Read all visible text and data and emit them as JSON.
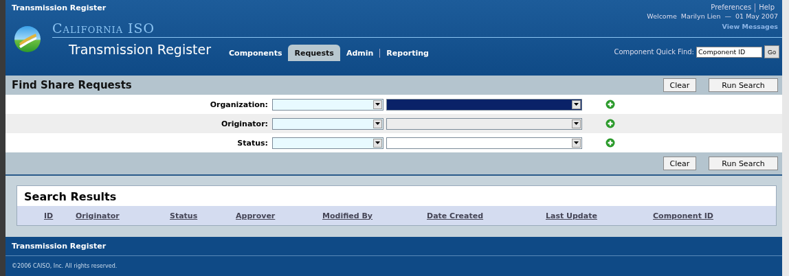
{
  "app_title": "Transmission Register",
  "header_links": [
    {
      "label": "Preferences"
    },
    {
      "label": "Help"
    }
  ],
  "welcome": "Welcome  Marilyn Lien  —  01 May 2007",
  "view_messages": "View Messages",
  "logo_text": "California ISO",
  "subtitle": "Transmission Register",
  "tabs": [
    {
      "label": "Components",
      "selected": false
    },
    {
      "label": "Requests",
      "selected": true
    },
    {
      "label": "Admin",
      "selected": false
    },
    {
      "label": "Reporting",
      "selected": false
    }
  ],
  "quick_find": {
    "label": "Component Quick Find:",
    "value": "Component ID",
    "button": "Go"
  },
  "search_panel": {
    "title": "Find Share Requests",
    "buttons": [
      "Clear",
      "Run Search"
    ],
    "bottom_buttons": [
      "Clear",
      "Run Search"
    ],
    "filters": [
      {
        "label": "Organization:",
        "kind": "highlighted"
      },
      {
        "label": "Originator:",
        "kind": "disabled"
      },
      {
        "label": "Status:",
        "kind": "normal"
      }
    ]
  },
  "results": {
    "title": "Search Results",
    "columns": [
      "ID",
      "Originator",
      "Status",
      "Approver",
      "Modified By",
      "Date Created",
      "Last Update",
      "Component ID"
    ]
  },
  "footer": {
    "title": "Transmission Register",
    "copyright": "©2006 CAISO, Inc. All rights reserved."
  }
}
